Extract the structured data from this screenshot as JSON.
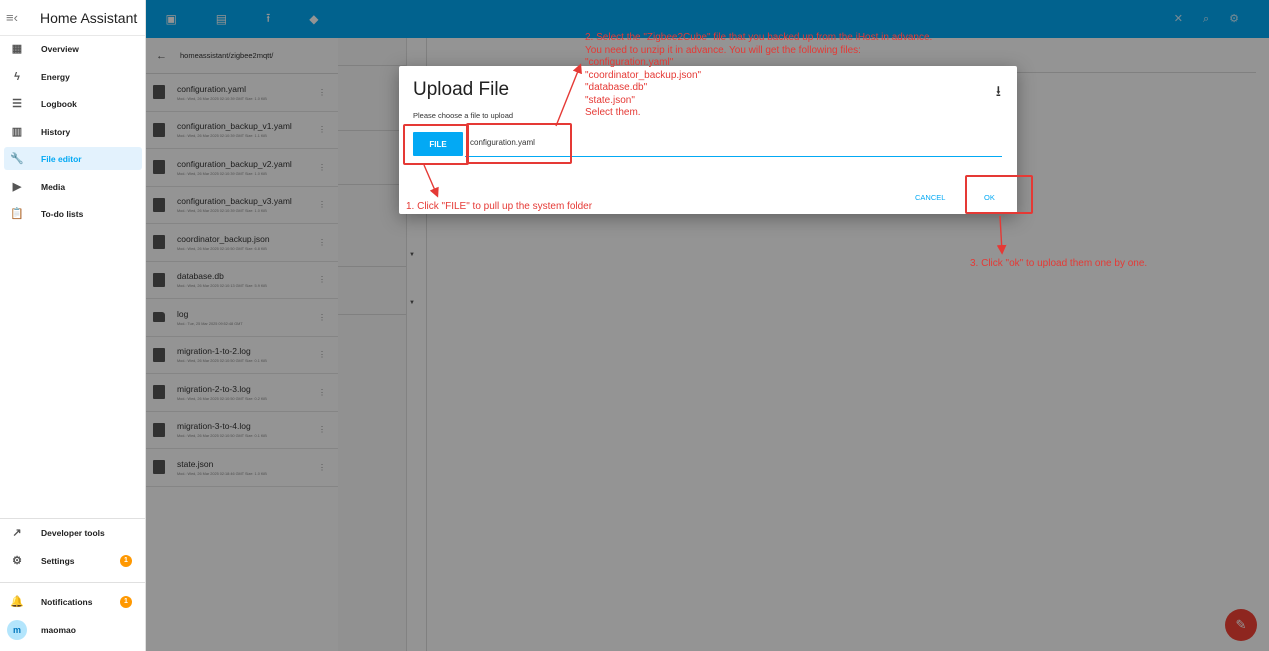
{
  "sidebar": {
    "title": "Home Assistant",
    "items": [
      {
        "label": "Overview",
        "icon": "dashboard-icon",
        "glyph": "▦"
      },
      {
        "label": "Energy",
        "icon": "lightning-icon",
        "glyph": "ϟ"
      },
      {
        "label": "Logbook",
        "icon": "list-icon",
        "glyph": "☰"
      },
      {
        "label": "History",
        "icon": "chart-icon",
        "glyph": "▥"
      },
      {
        "label": "File editor",
        "icon": "wrench-icon",
        "glyph": "🔧"
      },
      {
        "label": "Media",
        "icon": "media-icon",
        "glyph": "▶"
      },
      {
        "label": "To-do lists",
        "icon": "clipboard-icon",
        "glyph": "📋"
      }
    ],
    "developer_tools": "Developer tools",
    "settings": "Settings",
    "settings_badge": "1",
    "notifications": "Notifications",
    "notifications_badge": "1",
    "user_initial": "m",
    "user_name": "maomao"
  },
  "browser": {
    "path": "homeassistant/zigbee2mqtt/",
    "files": [
      {
        "name": "configuration.yaml",
        "meta": "Mod.: Wed, 26 Mar 2025 02:10:39 GMT   Size: 1.0 KiB",
        "type": "file"
      },
      {
        "name": "configuration_backup_v1.yaml",
        "meta": "Mod.: Wed, 26 Mar 2025 02:10:39 GMT   Size: 1.1 KiB",
        "type": "file"
      },
      {
        "name": "configuration_backup_v2.yaml",
        "meta": "Mod.: Wed, 26 Mar 2025 02:10:39 GMT   Size: 1.0 KiB",
        "type": "file"
      },
      {
        "name": "configuration_backup_v3.yaml",
        "meta": "Mod.: Wed, 26 Mar 2025 02:10:39 GMT   Size: 1.0 KiB",
        "type": "file"
      },
      {
        "name": "coordinator_backup.json",
        "meta": "Mod.: Wed, 26 Mar 2025 02:10:50 GMT   Size: 6.8 KiB",
        "type": "file"
      },
      {
        "name": "database.db",
        "meta": "Mod.: Wed, 26 Mar 2025 02:10:13 GMT   Size: 5.9 KiB",
        "type": "file"
      },
      {
        "name": "log",
        "meta": "Mod.: Tue, 25 Mar 2025 09:52:48 GMT",
        "type": "folder"
      },
      {
        "name": "migration-1-to-2.log",
        "meta": "Mod.: Wed, 26 Mar 2025 02:10:50 GMT   Size: 0.1 KiB",
        "type": "file"
      },
      {
        "name": "migration-2-to-3.log",
        "meta": "Mod.: Wed, 26 Mar 2025 02:10:50 GMT   Size: 0.2 KiB",
        "type": "file"
      },
      {
        "name": "migration-3-to-4.log",
        "meta": "Mod.: Wed, 26 Mar 2025 02:10:50 GMT   Size: 0.1 KiB",
        "type": "file"
      },
      {
        "name": "state.json",
        "meta": "Mod.: Wed, 26 Mar 2025 02:18:46 GMT   Size: 1.0 KiB",
        "type": "file"
      }
    ]
  },
  "dialog": {
    "title": "Upload File",
    "hint": "Please choose a file to upload",
    "file_button": "FILE",
    "file_name": "configuration.yaml",
    "cancel": "CANCEL",
    "ok": "OK"
  },
  "annotations": {
    "step1": "1. Click \"FILE\" to pull up the system folder",
    "step2": "2. Select the \"Zigbee2Cube\" file that you backed up from the iHost in advance.\nYou need to unzip it in advance. You will get the following files:\n\"configuration.yaml\"\n\"coordinator_backup.json\"\n\"database.db\"\n\"state.json\"\nSelect them.",
    "step3": "3. Click \"ok\" to upload them one by one.",
    "color": "#e53935"
  },
  "colors": {
    "primary": "#03a9f4",
    "badge": "#ff9800",
    "fab": "#f44336"
  }
}
